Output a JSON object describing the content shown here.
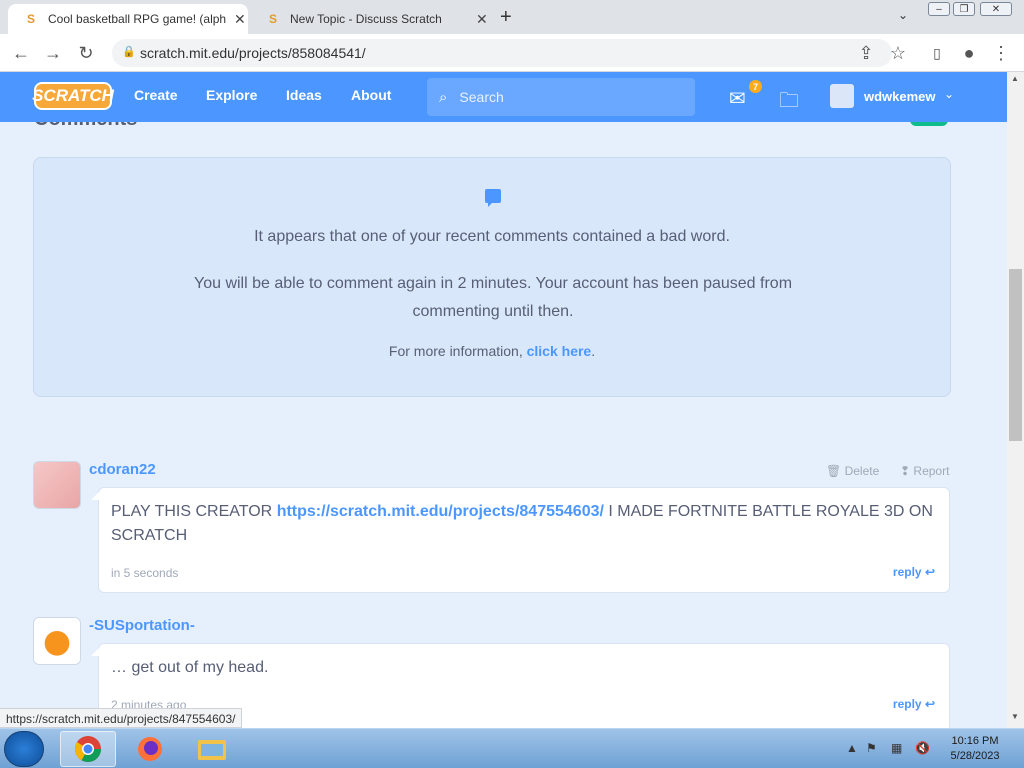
{
  "browser": {
    "tabs": [
      {
        "title": "Cool basketball RPG game! (alpha"
      },
      {
        "title": "New Topic - Discuss Scratch"
      }
    ],
    "new_tab": "+",
    "url": "scratch.mit.edu/projects/858084541/",
    "status_url": "https://scratch.mit.edu/projects/847554603/"
  },
  "header": {
    "logo": "SCRATCH",
    "nav": [
      "Create",
      "Explore",
      "Ideas",
      "About"
    ],
    "search_placeholder": "Search",
    "message_count": "7",
    "username": "wdwkemew"
  },
  "comments_section": {
    "heading": "Comments",
    "notice": {
      "line1": "It appears that one of your recent comments contained a bad word.",
      "line2": "You will be able to comment again in 2 minutes. Your account has been paused from commenting until then.",
      "info_prefix": "For more information, ",
      "info_link": "click here",
      "info_suffix": "."
    },
    "comments": [
      {
        "user": "cdoran22",
        "text_before": "PLAY THIS CREATOR ",
        "link": "https://scratch.mit.edu/projects/847554603/",
        "text_after": " I MADE FORTNITE BATTLE ROYALE 3D ON SCRATCH",
        "time": "in 5 seconds",
        "delete": "Delete",
        "report": "Report",
        "reply": "reply"
      },
      {
        "user": "-SUSportation-",
        "text": "… get out of my head.",
        "time": "2 minutes ago",
        "reply": "reply"
      }
    ]
  },
  "taskbar": {
    "time": "10:16 PM",
    "date": "5/28/2023"
  },
  "colors": {
    "scratch_blue": "#4c97ff",
    "notice_bg": "#d9e7fb",
    "page_bg": "#e6f0fc"
  }
}
